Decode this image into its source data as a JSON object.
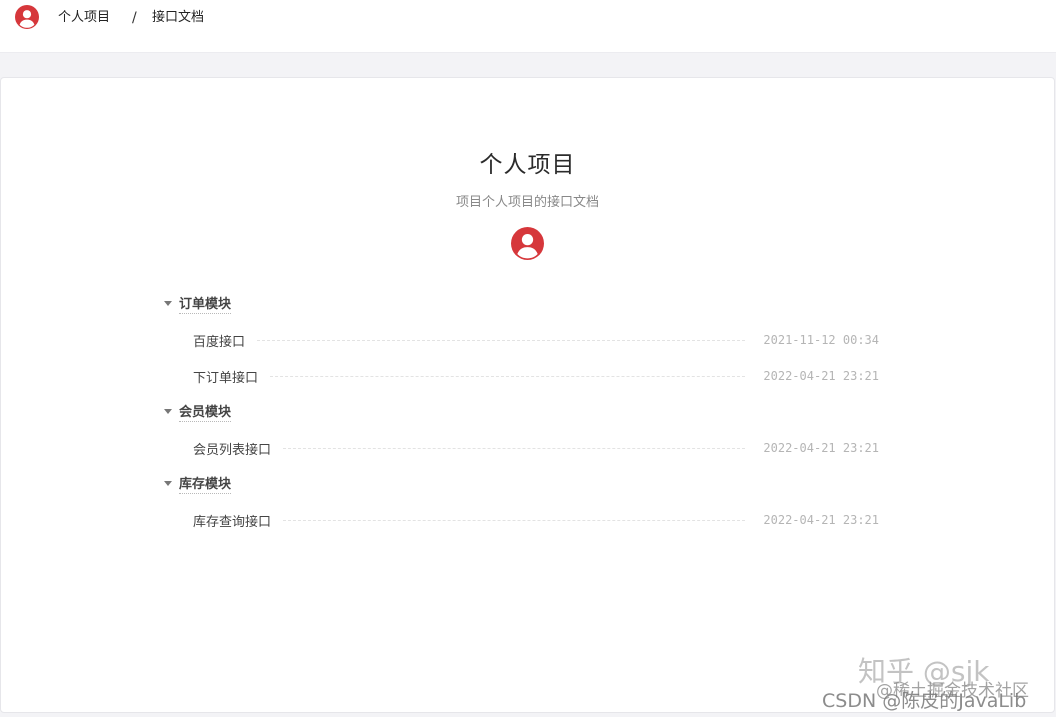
{
  "breadcrumb": {
    "project": "个人项目",
    "separator": "/",
    "current": "接口文档"
  },
  "doc": {
    "title": "个人项目",
    "subtitle": "项目个人项目的接口文档"
  },
  "groups": [
    {
      "label": "订单模块",
      "items": [
        {
          "label": "百度接口",
          "time": "2021-11-12 00:34"
        },
        {
          "label": "下订单接口",
          "time": "2022-04-21 23:21"
        }
      ]
    },
    {
      "label": "会员模块",
      "items": [
        {
          "label": "会员列表接口",
          "time": "2022-04-21 23:21"
        }
      ]
    },
    {
      "label": "库存模块",
      "items": [
        {
          "label": "库存查询接口",
          "time": "2022-04-21 23:21"
        }
      ]
    }
  ],
  "watermarks": {
    "zhihu": "知乎 @sjk",
    "juejin": "@稀土掘金技术社区",
    "csdn": "CSDN @陈皮的JavaLib"
  },
  "colors": {
    "avatar_red": "#d6373b",
    "card_bg": "#ffffff",
    "page_bg": "#f3f3f6"
  },
  "icons": {
    "avatar": "user-avatar-icon",
    "collapse": "caret-down-icon"
  }
}
